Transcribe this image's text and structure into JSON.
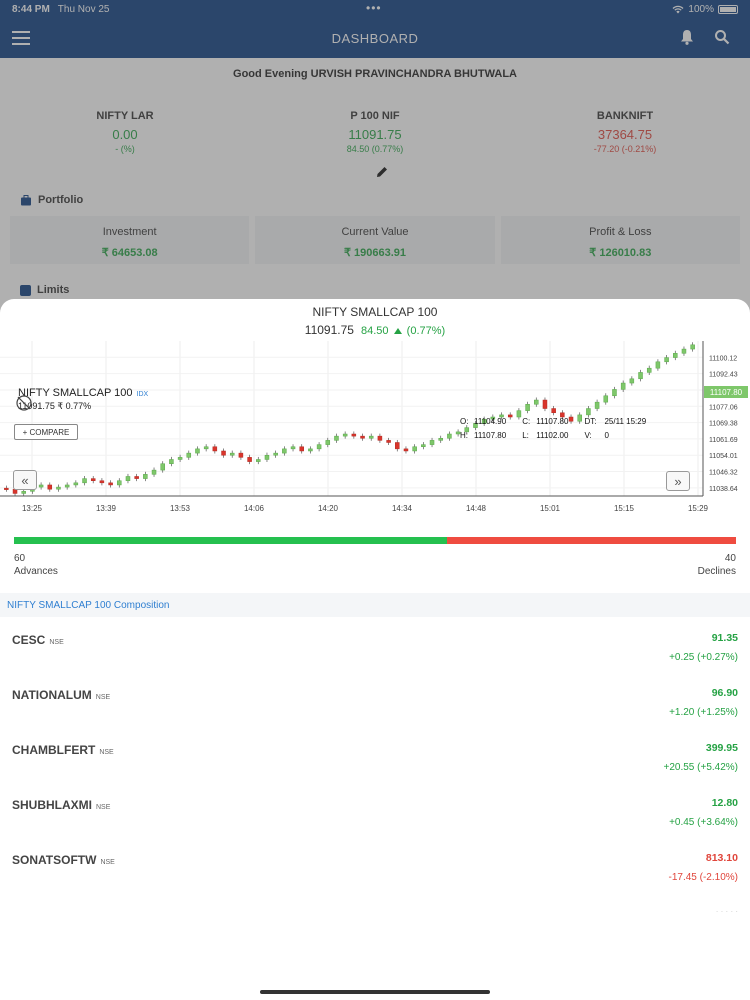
{
  "status_bar": {
    "time": "8:44 PM",
    "date": "Thu Nov 25",
    "battery": "100%"
  },
  "app_bar": {
    "title": "DASHBOARD"
  },
  "greeting": "Good Evening URVISH PRAVINCHANDRA BHUTWALA",
  "indices": [
    {
      "name": "NIFTY LAR",
      "value": "0.00",
      "change": "-  (%)",
      "color": "#25a244"
    },
    {
      "name": "P 100     NIF",
      "value": "11091.75",
      "change": "84.50  (0.77%)",
      "color": "#25a244"
    },
    {
      "name": "BANKNIFT",
      "value": "37364.75",
      "change": "-77.20  (-0.21%)",
      "color": "#e0453b"
    }
  ],
  "portfolio": {
    "title": "Portfolio",
    "cards": [
      {
        "label": "Investment",
        "value": "₹ 64653.08"
      },
      {
        "label": "Current Value",
        "value": "₹ 190663.91"
      },
      {
        "label": "Profit & Loss",
        "value": "₹ 126010.83"
      }
    ]
  },
  "limits": {
    "title": "Limits"
  },
  "sheet": {
    "title": "NIFTY SMALLCAP 100",
    "price": "11091.75",
    "change": "84.50",
    "change_pct": "(0.77%)"
  },
  "chart_data": {
    "type": "candlestick",
    "title": "NIFTY SMALLCAP 100",
    "tag": "IDX",
    "legend_price": "11091.75 ₹ 0.77%",
    "compare_label": "+ COMPARE",
    "ohlc": {
      "O": "11104.90",
      "C": "11107.80",
      "DT": "25/11 15:29",
      "H": "11107.80",
      "L": "11102.00",
      "V": "0"
    },
    "last_price_tag": "11107.80",
    "x_ticks": [
      "13:25",
      "13:39",
      "13:53",
      "14:06",
      "14:20",
      "14:34",
      "14:48",
      "15:01",
      "15:15",
      "15:29"
    ],
    "y_ticks": [
      "11100.12",
      "11092.43",
      "11084.75",
      "11077.06",
      "11069.38",
      "11061.69",
      "11054.01",
      "11046.32",
      "11038.64"
    ],
    "ylim": [
      11034.8,
      11107.8
    ],
    "series_close": [
      11038,
      11036,
      11037,
      11039,
      11040,
      11038,
      11039,
      11040,
      11041,
      11043,
      11042,
      11041,
      11040,
      11042,
      11044,
      11043,
      11045,
      11047,
      11050,
      11052,
      11053,
      11055,
      11057,
      11058,
      11056,
      11054,
      11055,
      11053,
      11051,
      11052,
      11054,
      11055,
      11057,
      11058,
      11056,
      11057,
      11059,
      11061,
      11063,
      11064,
      11063,
      11062,
      11063,
      11061,
      11060,
      11057,
      11056,
      11058,
      11059,
      11061,
      11062,
      11064,
      11065,
      11067,
      11069,
      11071,
      11072,
      11073,
      11072,
      11075,
      11078,
      11080,
      11076,
      11074,
      11072,
      11070,
      11073,
      11076,
      11079,
      11082,
      11085,
      11088,
      11090,
      11093,
      11095,
      11098,
      11100,
      11102,
      11104,
      11106
    ]
  },
  "breadth": {
    "advances": "60",
    "advances_label": "Advances",
    "declines": "40",
    "declines_label": "Declines",
    "advance_ratio": 0.6
  },
  "composition": {
    "title": "NIFTY SMALLCAP 100 Composition",
    "items": [
      {
        "symbol": "CESC",
        "exchange": "NSE",
        "ltp": "91.35",
        "change": "+0.25 (+0.27%)",
        "color": "#25a244"
      },
      {
        "symbol": "NATIONALUM",
        "exchange": "NSE",
        "ltp": "96.90",
        "change": "+1.20 (+1.25%)",
        "color": "#25a244"
      },
      {
        "symbol": "CHAMBLFERT",
        "exchange": "NSE",
        "ltp": "399.95",
        "change": "+20.55 (+5.42%)",
        "color": "#25a244"
      },
      {
        "symbol": "SHUBHLAXMI",
        "exchange": "NSE",
        "ltp": "12.80",
        "change": "+0.45 (+3.64%)",
        "color": "#25a244"
      },
      {
        "symbol": "SONATSOFTW",
        "exchange": "NSE",
        "ltp": "813.10",
        "change": "-17.45 (-2.10%)",
        "color": "#e0453b"
      }
    ]
  }
}
